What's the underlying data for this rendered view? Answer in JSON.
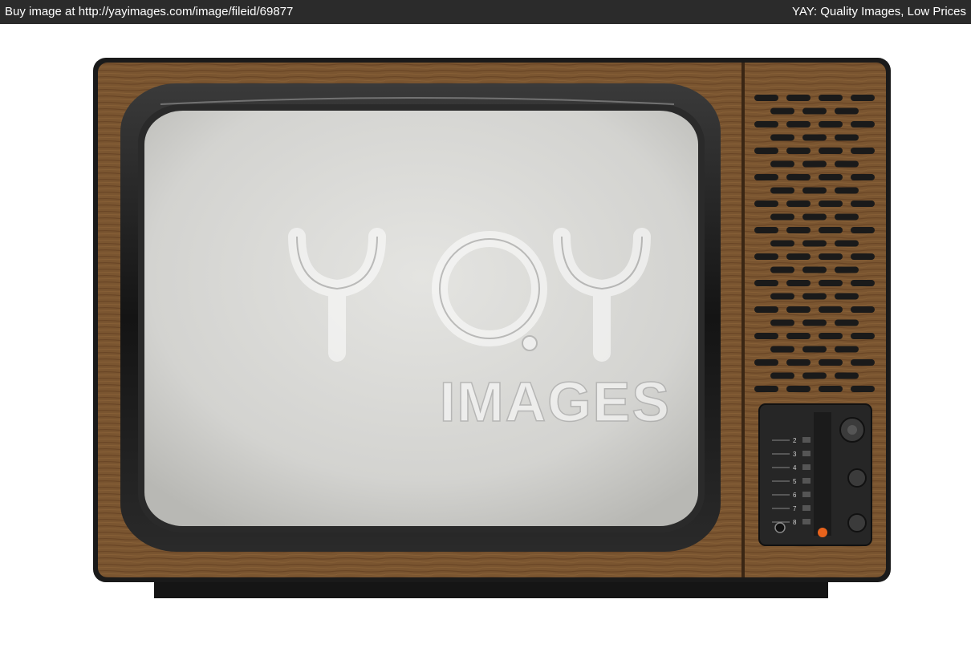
{
  "top_bar": {
    "left_text": "Buy image at http://yayimages.com/image/fileid/69877",
    "right_text": "YAY: Quality Images, Low Prices",
    "background": "#2b2b2b",
    "text_color": "#ffffff"
  },
  "photo": {
    "subject": "Vintage wood-grain television set with blank gray screen, speaker grille and control panel",
    "colors": {
      "wood": "#7a5530",
      "wood_dark": "#4e3218",
      "bezel": "#1c1c1c",
      "screen": "#d9d9d6",
      "panel": "#262626",
      "indicator": "#e8631c"
    },
    "channel_labels": [
      "2",
      "3",
      "4",
      "5",
      "6",
      "7",
      "8"
    ]
  },
  "watermark": {
    "logo": "YAY",
    "text": "IMAGES"
  }
}
